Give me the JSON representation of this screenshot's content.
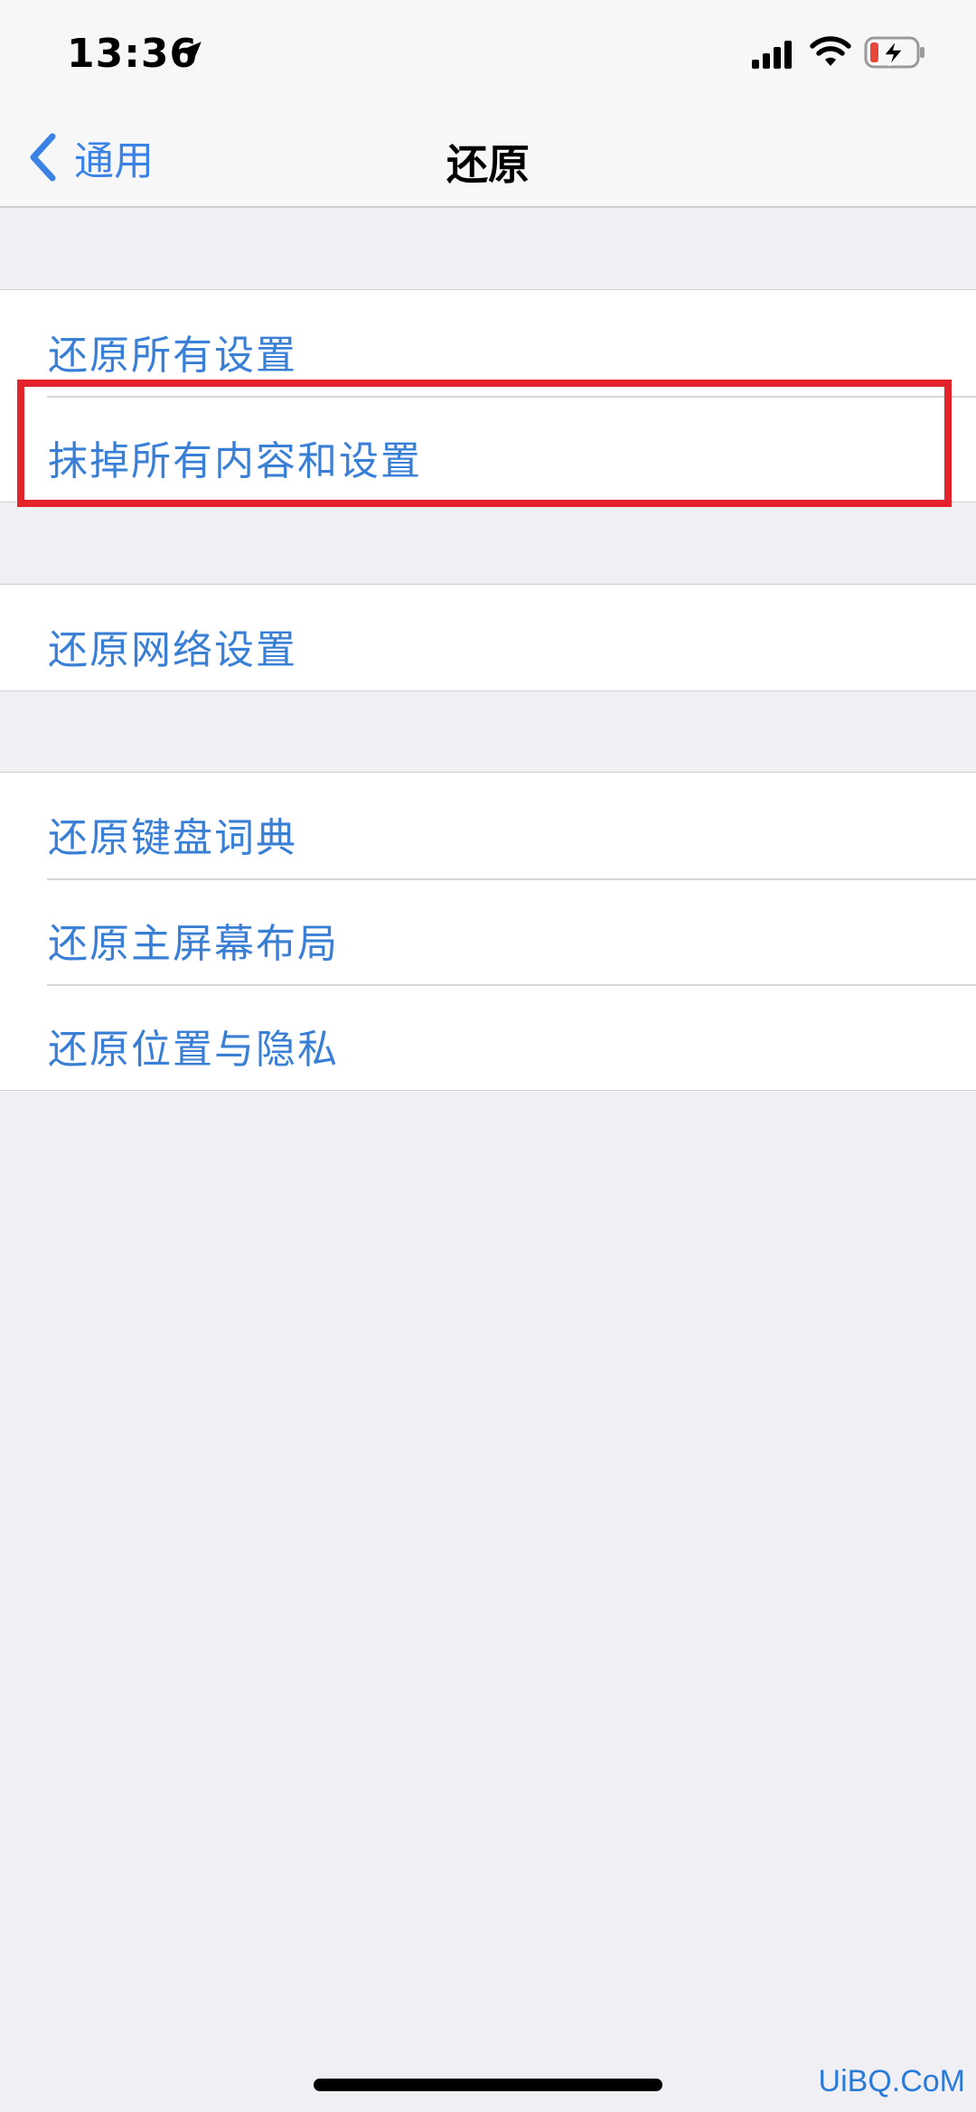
{
  "status_bar": {
    "time": "13:36",
    "location_icon": "location-arrow-icon",
    "signal_icon": "cellular-signal-icon",
    "wifi_icon": "wifi-icon",
    "battery_icon": "battery-charging-low-icon"
  },
  "nav": {
    "back_label": "通用",
    "title": "还原"
  },
  "groups": [
    {
      "rows": [
        "还原所有设置",
        "抹掉所有内容和设置"
      ]
    },
    {
      "rows": [
        "还原网络设置"
      ]
    },
    {
      "rows": [
        "还原键盘词典",
        "还原主屏幕布局",
        "还原位置与隐私"
      ]
    }
  ],
  "highlight": {
    "target": "抹掉所有内容和设置",
    "color": "#e3232b"
  },
  "colors": {
    "accent": "#3a7fd6",
    "background": "#efeff4",
    "battery_low": "#e5473b"
  },
  "watermark": "UiBQ.CoM"
}
